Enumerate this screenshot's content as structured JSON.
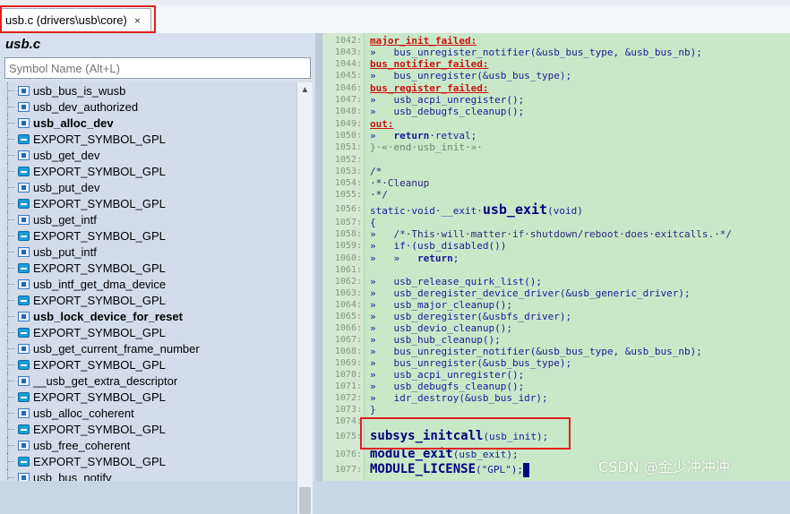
{
  "tab": {
    "label": "usb.c (drivers\\usb\\core)",
    "close": "×"
  },
  "sidebar": {
    "title": "usb.c",
    "search_placeholder": "Symbol Name (Alt+L)",
    "scroll_up": "▲",
    "items": [
      {
        "label": "usb_bus_is_wusb",
        "kind": "func",
        "bold": false
      },
      {
        "label": "usb_dev_authorized",
        "kind": "func",
        "bold": false
      },
      {
        "label": "usb_alloc_dev",
        "kind": "func",
        "bold": true
      },
      {
        "label": "EXPORT_SYMBOL_GPL",
        "kind": "macro",
        "bold": false
      },
      {
        "label": "usb_get_dev",
        "kind": "func",
        "bold": false
      },
      {
        "label": "EXPORT_SYMBOL_GPL",
        "kind": "macro",
        "bold": false
      },
      {
        "label": "usb_put_dev",
        "kind": "func",
        "bold": false
      },
      {
        "label": "EXPORT_SYMBOL_GPL",
        "kind": "macro",
        "bold": false
      },
      {
        "label": "usb_get_intf",
        "kind": "func",
        "bold": false
      },
      {
        "label": "EXPORT_SYMBOL_GPL",
        "kind": "macro",
        "bold": false
      },
      {
        "label": "usb_put_intf",
        "kind": "func",
        "bold": false
      },
      {
        "label": "EXPORT_SYMBOL_GPL",
        "kind": "macro",
        "bold": false
      },
      {
        "label": "usb_intf_get_dma_device",
        "kind": "func",
        "bold": false
      },
      {
        "label": "EXPORT_SYMBOL_GPL",
        "kind": "macro",
        "bold": false
      },
      {
        "label": "usb_lock_device_for_reset",
        "kind": "func",
        "bold": true
      },
      {
        "label": "EXPORT_SYMBOL_GPL",
        "kind": "macro",
        "bold": false
      },
      {
        "label": "usb_get_current_frame_number",
        "kind": "func",
        "bold": false
      },
      {
        "label": "EXPORT_SYMBOL_GPL",
        "kind": "macro",
        "bold": false
      },
      {
        "label": "__usb_get_extra_descriptor",
        "kind": "func",
        "bold": false
      },
      {
        "label": "EXPORT_SYMBOL_GPL",
        "kind": "macro",
        "bold": false
      },
      {
        "label": "usb_alloc_coherent",
        "kind": "func",
        "bold": false
      },
      {
        "label": "EXPORT_SYMBOL_GPL",
        "kind": "macro",
        "bold": false
      },
      {
        "label": "usb_free_coherent",
        "kind": "func",
        "bold": false
      },
      {
        "label": "EXPORT_SYMBOL_GPL",
        "kind": "macro",
        "bold": false
      },
      {
        "label": "usb_bus_notify",
        "kind": "func",
        "bold": false
      }
    ]
  },
  "code": {
    "line_numbers": [
      "1042:",
      "1043:",
      "1044:",
      "1045:",
      "1046:",
      "1047:",
      "1048:",
      "1049:",
      "1050:",
      "1051:",
      "1052:",
      "1053:",
      "1054:",
      "1055:",
      "1056:",
      "1057:",
      "1058:",
      "1059:",
      "1060:",
      "1061:",
      "1062:",
      "1063:",
      "1064:",
      "1065:",
      "1066:",
      "1067:",
      "1068:",
      "1069:",
      "1070:",
      "1071:",
      "1072:",
      "1073:",
      "1074:",
      "1075:",
      "1076:",
      "1077:"
    ],
    "l1042": "major_init_failed:",
    "l1043": "»   bus_unregister_notifier(&usb_bus_type, &usb_bus_nb);",
    "l1044": "bus_notifier_failed:",
    "l1045": "»   bus_unregister(&usb_bus_type);",
    "l1046": "bus_register_failed:",
    "l1047": "»   usb_acpi_unregister();",
    "l1048": "»   usb_debugfs_cleanup();",
    "l1049": "out:",
    "l1050a": "»   ",
    "l1050b": "return",
    "l1050c": "·retval;",
    "l1051": "}·«·end·usb_init·»·",
    "l1053": "/*",
    "l1054": "·*·Cleanup",
    "l1055": "·*/",
    "l1056a": "static·void·__exit·",
    "l1056b": "usb_exit",
    "l1056c": "(void)",
    "l1057": "{",
    "l1058": "»   /*·This·will·matter·if·shutdown/reboot·does·exitcalls.·*/",
    "l1059": "»   if·(usb_disabled())",
    "l1060a": "»   »   ",
    "l1060b": "return",
    "l1060c": ";",
    "l1062": "»   usb_release_quirk_list();",
    "l1063": "»   usb_deregister_device_driver(&usb_generic_driver);",
    "l1064": "»   usb_major_cleanup();",
    "l1065": "»   usb_deregister(&usbfs_driver);",
    "l1066": "»   usb_devio_cleanup();",
    "l1067": "»   usb_hub_cleanup();",
    "l1068": "»   bus_unregister_notifier(&usb_bus_type, &usb_bus_nb);",
    "l1069": "»   bus_unregister(&usb_bus_type);",
    "l1070": "»   usb_acpi_unregister();",
    "l1071": "»   usb_debugfs_cleanup();",
    "l1072": "»   idr_destroy(&usb_bus_idr);",
    "l1073": "}",
    "l1075a": "subsys_initcall",
    "l1075b": "(usb_init);",
    "l1076a": "module_exit",
    "l1076b": "(usb_exit);",
    "l1077a": "MODULE_LICENSE",
    "l1077b": "(\"GPL\");"
  },
  "watermark": "CSDN @金少冲冲冲",
  "colors": {
    "highlight_box": "#e02020",
    "code_bg": "#c8e9c8",
    "label_red": "#d01010"
  }
}
